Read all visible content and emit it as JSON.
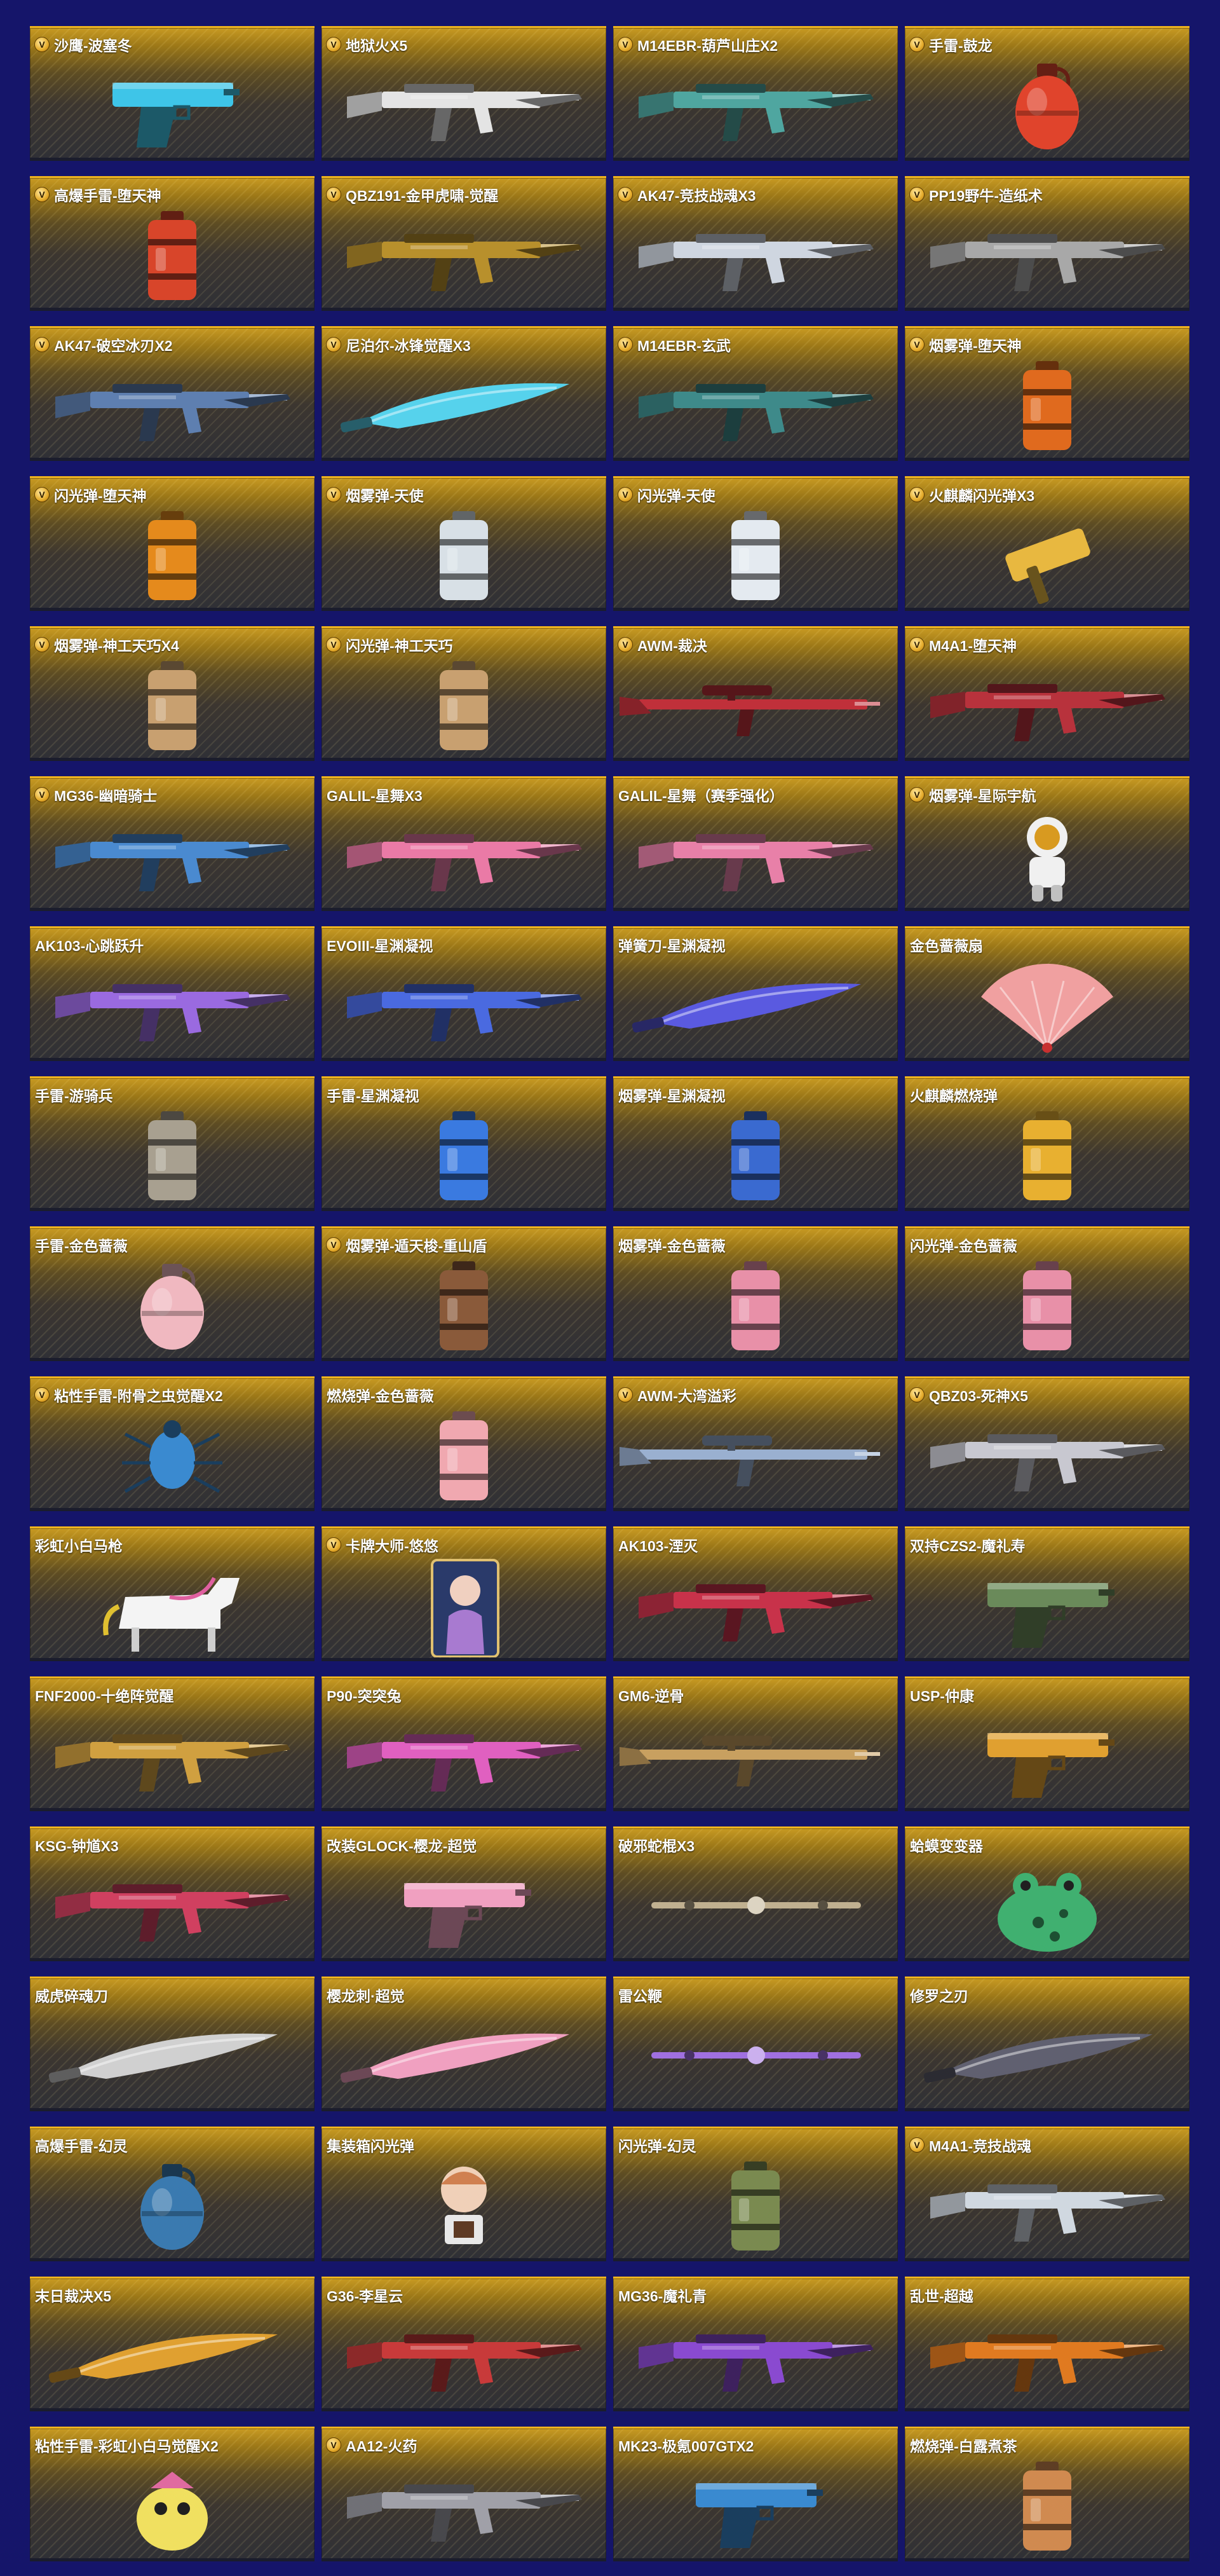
{
  "items": [
    {
      "name": "沙鹰-波塞冬",
      "vip": true,
      "icon": "pistol-icon",
      "color": "#3ec5e8"
    },
    {
      "name": "地狱火X5",
      "vip": true,
      "icon": "rifle-icon",
      "color": "#e4e4e4"
    },
    {
      "name": "M14EBR-葫芦山庄X2",
      "vip": true,
      "icon": "rifle-icon",
      "color": "#4fa6a0"
    },
    {
      "name": "手雷-鼓龙",
      "vip": true,
      "icon": "grenade-icon",
      "color": "#e0442c"
    },
    {
      "name": "高爆手雷-堕天神",
      "vip": true,
      "icon": "canister-icon",
      "color": "#d8452a"
    },
    {
      "name": "QBZ191-金甲虎啸-觉醒",
      "vip": true,
      "icon": "rifle-icon",
      "color": "#b8902c"
    },
    {
      "name": "AK47-竞技战魂X3",
      "vip": true,
      "icon": "rifle-icon",
      "color": "#cfd6e0"
    },
    {
      "name": "PP19野牛-造纸术",
      "vip": true,
      "icon": "rifle-icon",
      "color": "#a8a8a8"
    },
    {
      "name": "AK47-破空冰刃X2",
      "vip": true,
      "icon": "rifle-icon",
      "color": "#5e7fb0"
    },
    {
      "name": "尼泊尔-冰锋觉醒X3",
      "vip": true,
      "icon": "blade-icon",
      "color": "#56d2ec"
    },
    {
      "name": "M14EBR-玄武",
      "vip": true,
      "icon": "rifle-icon",
      "color": "#3e8a8a"
    },
    {
      "name": "烟雾弹-堕天神",
      "vip": true,
      "icon": "canister-icon",
      "color": "#e06a1e"
    },
    {
      "name": "闪光弹-堕天神",
      "vip": true,
      "icon": "canister-icon",
      "color": "#e58a1c"
    },
    {
      "name": "烟雾弹-天使",
      "vip": true,
      "icon": "canister-icon",
      "color": "#d8e0e6"
    },
    {
      "name": "闪光弹-天使",
      "vip": true,
      "icon": "canister-icon",
      "color": "#e4eaf0"
    },
    {
      "name": "火麒麟闪光弹X3",
      "vip": true,
      "icon": "hammer-icon",
      "color": "#e8b840"
    },
    {
      "name": "烟雾弹-神工天巧X4",
      "vip": true,
      "icon": "canister-icon",
      "color": "#c8a070"
    },
    {
      "name": "闪光弹-神工天巧",
      "vip": true,
      "icon": "canister-icon",
      "color": "#c8a070"
    },
    {
      "name": "AWM-裁决",
      "vip": true,
      "icon": "sniper-icon",
      "color": "#c0303a"
    },
    {
      "name": "M4A1-堕天神",
      "vip": true,
      "icon": "rifle-icon",
      "color": "#b8323c"
    },
    {
      "name": "MG36-幽暗骑士",
      "vip": true,
      "icon": "rifle-icon",
      "color": "#4a8ad0"
    },
    {
      "name": "GALIL-星舞X3",
      "vip": false,
      "icon": "rifle-icon",
      "color": "#ea7aa6"
    },
    {
      "name": "GALIL-星舞（赛季强化）",
      "vip": false,
      "icon": "rifle-icon",
      "color": "#e880a8"
    },
    {
      "name": "烟雾弹-星际宇航",
      "vip": true,
      "icon": "astronaut-icon",
      "color": "#f0f0f0"
    },
    {
      "name": "AK103-心跳跃升",
      "vip": false,
      "icon": "rifle-icon",
      "color": "#9a6ae0"
    },
    {
      "name": "EVOIII-星渊凝视",
      "vip": false,
      "icon": "rifle-icon",
      "color": "#4a6ae0"
    },
    {
      "name": "弹簧刀-星渊凝视",
      "vip": false,
      "icon": "blade-icon",
      "color": "#5a5ae0"
    },
    {
      "name": "金色蔷薇扇",
      "vip": false,
      "icon": "fan-icon",
      "color": "#f0a0a0"
    },
    {
      "name": "手雷-游骑兵",
      "vip": false,
      "icon": "canister-icon",
      "color": "#a8a090"
    },
    {
      "name": "手雷-星渊凝视",
      "vip": false,
      "icon": "canister-icon",
      "color": "#3a7ae0"
    },
    {
      "name": "烟雾弹-星渊凝视",
      "vip": false,
      "icon": "canister-icon",
      "color": "#3a6ad0"
    },
    {
      "name": "火麒麟燃烧弹",
      "vip": false,
      "icon": "canister-icon",
      "color": "#e8b030"
    },
    {
      "name": "手雷-金色蔷薇",
      "vip": false,
      "icon": "grenade-icon",
      "color": "#f0b8c0"
    },
    {
      "name": "烟雾弹-遁天梭-重山盾",
      "vip": true,
      "icon": "canister-icon",
      "color": "#8a5a3a"
    },
    {
      "name": "烟雾弹-金色蔷薇",
      "vip": false,
      "icon": "canister-icon",
      "color": "#e890a8"
    },
    {
      "name": "闪光弹-金色蔷薇",
      "vip": false,
      "icon": "canister-icon",
      "color": "#e890a8"
    },
    {
      "name": "粘性手雷-附骨之虫觉醒X2",
      "vip": true,
      "icon": "bug-icon",
      "color": "#3a8ad0"
    },
    {
      "name": "燃烧弹-金色蔷薇",
      "vip": false,
      "icon": "canister-icon",
      "color": "#f0a8b0"
    },
    {
      "name": "AWM-大湾溢彩",
      "vip": true,
      "icon": "sniper-icon",
      "color": "#9ab0d0"
    },
    {
      "name": "QBZ03-死神X5",
      "vip": true,
      "icon": "rifle-icon",
      "color": "#c8c8d0"
    },
    {
      "name": "彩虹小白马枪",
      "vip": false,
      "icon": "horse-icon",
      "color": "#f4f4f4"
    },
    {
      "name": "卡牌大师-悠悠",
      "vip": true,
      "icon": "card-icon",
      "color": "#a87ad0"
    },
    {
      "name": "AK103-湮灭",
      "vip": false,
      "icon": "rifle-icon",
      "color": "#c8324a"
    },
    {
      "name": "双持CZS2-魔礼寿",
      "vip": false,
      "icon": "pistol-icon",
      "color": "#6a8a5a"
    },
    {
      "name": "FNF2000-十绝阵觉醒",
      "vip": false,
      "icon": "rifle-icon",
      "color": "#d0a040"
    },
    {
      "name": "P90-突突兔",
      "vip": false,
      "icon": "rifle-icon",
      "color": "#e060c0"
    },
    {
      "name": "GM6-逆骨",
      "vip": false,
      "icon": "sniper-icon",
      "color": "#c8a060"
    },
    {
      "name": "USP-仲康",
      "vip": false,
      "icon": "pistol-icon",
      "color": "#e0a030"
    },
    {
      "name": "KSG-钟馗X3",
      "vip": false,
      "icon": "rifle-icon",
      "color": "#d04060"
    },
    {
      "name": "改装GLOCK-樱龙-超觉",
      "vip": false,
      "icon": "pistol-icon",
      "color": "#f0a0c0"
    },
    {
      "name": "破邪蛇棍X3",
      "vip": false,
      "icon": "staff-icon",
      "color": "#c0b090"
    },
    {
      "name": "蛤蟆变变器",
      "vip": false,
      "icon": "frog-icon",
      "color": "#40b070"
    },
    {
      "name": "威虎碎魂刀",
      "vip": false,
      "icon": "blade-icon",
      "color": "#d0d0d0"
    },
    {
      "name": "樱龙刺·超觉",
      "vip": false,
      "icon": "blade-icon",
      "color": "#f0a0c0"
    },
    {
      "name": "雷公鞭",
      "vip": false,
      "icon": "staff-icon",
      "color": "#a070e0"
    },
    {
      "name": "修罗之刃",
      "vip": false,
      "icon": "blade-icon",
      "color": "#606070"
    },
    {
      "name": "高爆手雷-幻灵",
      "vip": false,
      "icon": "grenade-icon",
      "color": "#3a7ab0"
    },
    {
      "name": "集装箱闪光弹",
      "vip": false,
      "icon": "figure-icon",
      "color": "#d08050"
    },
    {
      "name": "闪光弹-幻灵",
      "vip": false,
      "icon": "canister-icon",
      "color": "#7a8a50"
    },
    {
      "name": "M4A1-竞技战魂",
      "vip": true,
      "icon": "rifle-icon",
      "color": "#d0d8e0"
    },
    {
      "name": "末日裁决X5",
      "vip": false,
      "icon": "blade-icon",
      "color": "#e0a030"
    },
    {
      "name": "G36-李星云",
      "vip": false,
      "icon": "rifle-icon",
      "color": "#c83a3a"
    },
    {
      "name": "MG36-魔礼青",
      "vip": false,
      "icon": "rifle-icon",
      "color": "#8a4ad0"
    },
    {
      "name": "乱世-超越",
      "vip": false,
      "icon": "rifle-icon",
      "color": "#e07a20"
    },
    {
      "name": "粘性手雷-彩虹小白马觉醒X2",
      "vip": false,
      "icon": "creature-icon",
      "color": "#f0e060"
    },
    {
      "name": "AA12-火药",
      "vip": true,
      "icon": "rifle-icon",
      "color": "#a0a0a8"
    },
    {
      "name": "MK23-极氪007GTX2",
      "vip": false,
      "icon": "pistol-icon",
      "color": "#3a8ad0"
    },
    {
      "name": "燃烧弹-白露煮茶",
      "vip": false,
      "icon": "canister-icon",
      "color": "#d08a50"
    }
  ]
}
